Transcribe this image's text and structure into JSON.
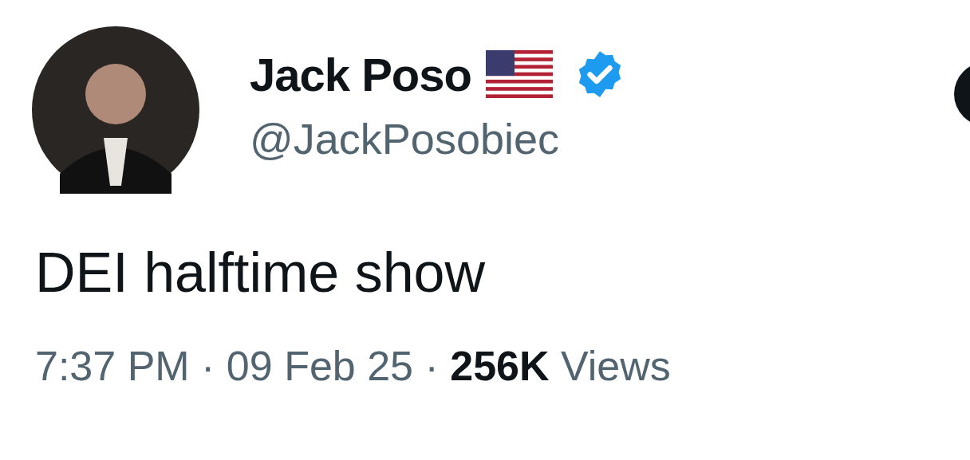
{
  "author": {
    "name": "Jack Poso",
    "handle": "@JackPosobiec",
    "flag": true,
    "verified": true
  },
  "tweet": {
    "text": "DEI halftime show",
    "meta": "7:37 PM · 09 Feb 25 · **256K** Views"
  }
}
